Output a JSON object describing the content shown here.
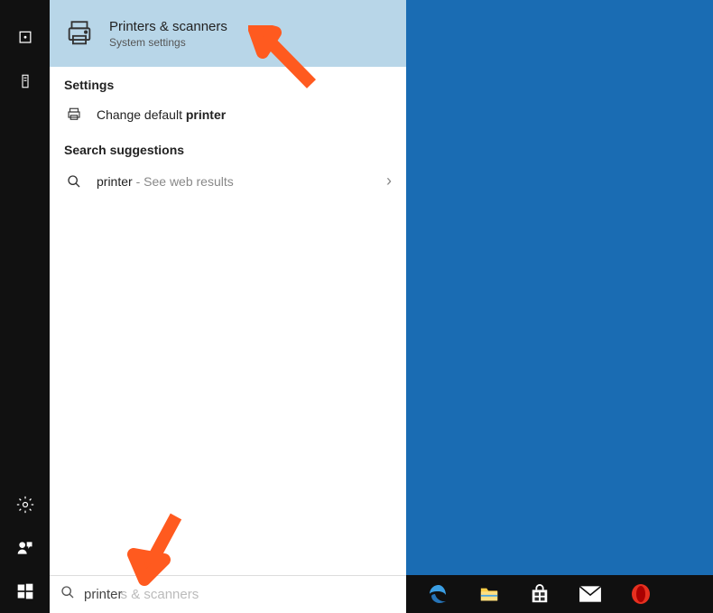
{
  "bestMatch": {
    "titlePrefix": "Printer",
    "titleSuffix": "s & scanners",
    "subtitle": "System settings"
  },
  "sections": {
    "settings": "Settings",
    "searchSuggestions": "Search suggestions"
  },
  "settingsRow": {
    "prefix": "Change default ",
    "bold": "printer"
  },
  "suggestionRow": {
    "query": "printer",
    "suffix": " - ",
    "sub": "See web results"
  },
  "searchBox": {
    "typed": "printer",
    "ghost": "s & scanners"
  },
  "taskbar": {
    "items": [
      "edge-icon",
      "file-explorer-icon",
      "store-icon",
      "mail-icon",
      "opera-icon"
    ]
  }
}
